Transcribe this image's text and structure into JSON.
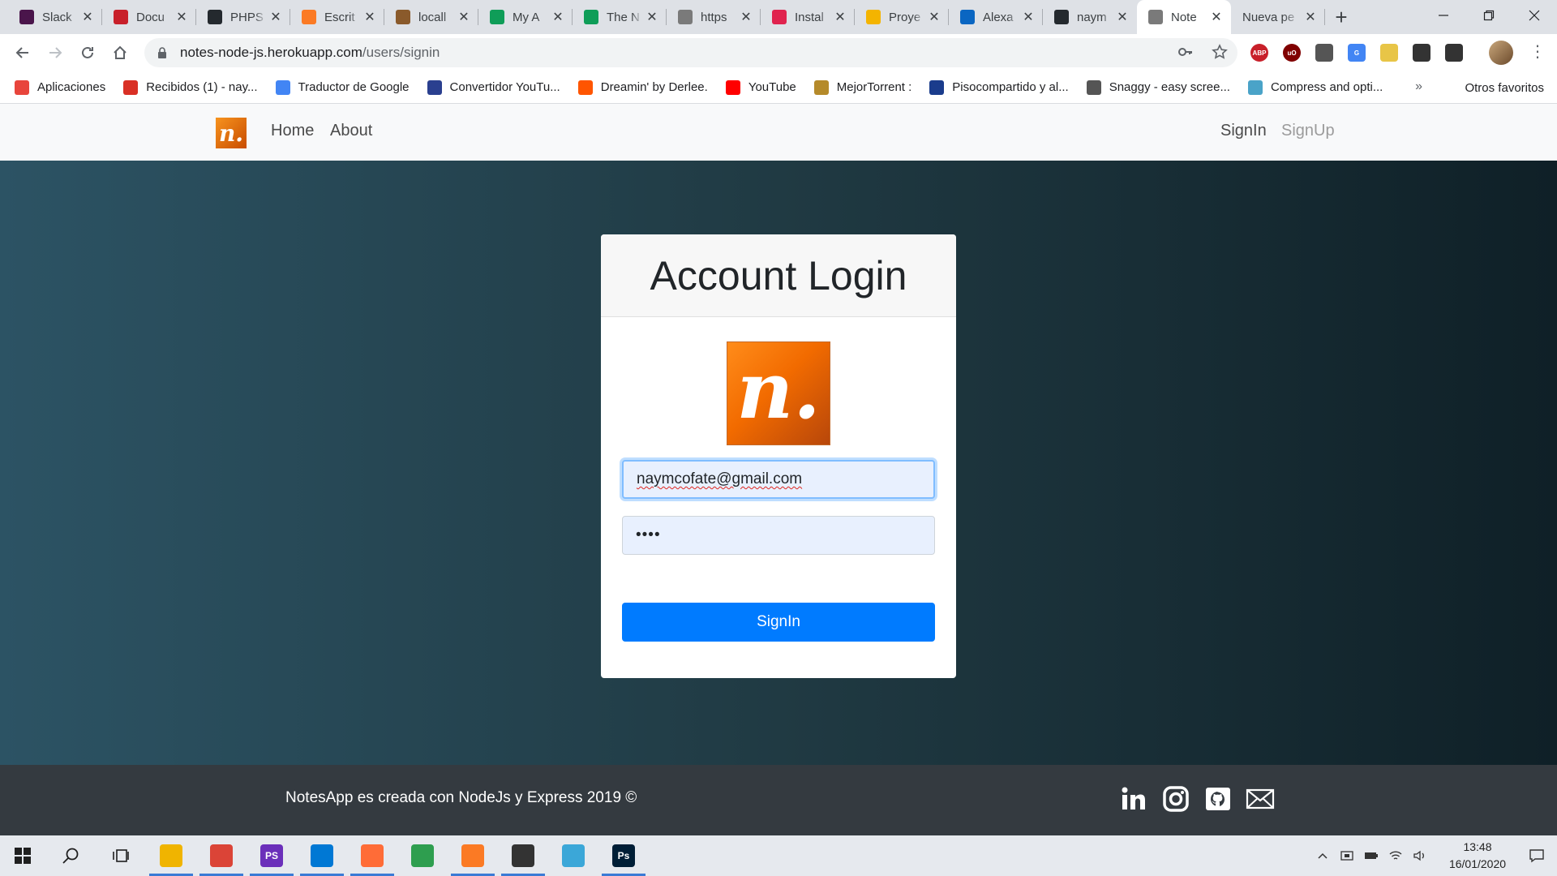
{
  "browser": {
    "tabs": [
      {
        "title": "Slack",
        "icon": "slack-icon",
        "color": "#4a154b"
      },
      {
        "title": "Docu",
        "icon": "pdf-icon",
        "color": "#c8202a"
      },
      {
        "title": "PHPS",
        "icon": "github-icon",
        "color": "#24292e"
      },
      {
        "title": "Escrit",
        "icon": "xampp-icon",
        "color": "#fb7a24"
      },
      {
        "title": "locall",
        "icon": "tent-icon",
        "color": "#8a5a2b"
      },
      {
        "title": "My A",
        "icon": "sheet-icon",
        "color": "#0f9d58"
      },
      {
        "title": "The N",
        "icon": "sheet-icon",
        "color": "#0f9d58"
      },
      {
        "title": "https",
        "icon": "globe-icon",
        "color": "#7a7a7a"
      },
      {
        "title": "Instal",
        "icon": "nest-icon",
        "color": "#e0234e"
      },
      {
        "title": "Proye",
        "icon": "slides-icon",
        "color": "#f4b400"
      },
      {
        "title": "Alexa",
        "icon": "linkedin-icon",
        "color": "#0a66c2"
      },
      {
        "title": "naym",
        "icon": "github-icon",
        "color": "#24292e"
      },
      {
        "title": "Note",
        "icon": "globe-icon",
        "color": "#7a7a7a",
        "active": true
      },
      {
        "title": "Nueva pe",
        "icon": "none",
        "color": "#ffffff"
      }
    ],
    "new_tab_label": "+",
    "url_host": "notes-node-js.herokuapp.com",
    "url_path": "/users/signin",
    "extensions": [
      {
        "label": "ABP",
        "color": "#c8202a"
      },
      {
        "label": "uO",
        "color": "#800000"
      },
      {
        "label": "",
        "color": "#555555"
      },
      {
        "label": "G",
        "color": "#4285f4"
      },
      {
        "label": "",
        "color": "#e8c547"
      },
      {
        "label": "",
        "color": "#333333"
      },
      {
        "label": "",
        "color": "#333333"
      }
    ],
    "bookmarks": [
      {
        "label": "Aplicaciones",
        "color": "#e8453c"
      },
      {
        "label": "Recibidos (1) - nay...",
        "color": "#d93025"
      },
      {
        "label": "Traductor de Google",
        "color": "#4285f4"
      },
      {
        "label": "Convertidor YouTu...",
        "color": "#2a3f8f"
      },
      {
        "label": "Dreamin' by Derlee.",
        "color": "#ff5500"
      },
      {
        "label": "YouTube",
        "color": "#ff0000"
      },
      {
        "label": "MejorTorrent :",
        "color": "#b58a2a"
      },
      {
        "label": "Pisocompartido y al...",
        "color": "#1a3c8c"
      },
      {
        "label": "Snaggy - easy scree...",
        "color": "#555555"
      },
      {
        "label": "Compress and opti...",
        "color": "#4aa3c8"
      }
    ],
    "bookmarks_more": "»",
    "other_bookmarks": "Otros favoritos"
  },
  "site": {
    "nav": {
      "brand": "n.",
      "links": [
        "Home",
        "About"
      ],
      "right_links": [
        "SignIn",
        "SignUp"
      ]
    },
    "login": {
      "title": "Account Login",
      "logo_letter": "n.",
      "email": "naymcofate@gmail.com",
      "password": "••••",
      "submit": "SignIn"
    },
    "footer": {
      "text": "NotesApp es creada con NodeJs y Express 2019 ©",
      "socials": [
        "linkedin-icon",
        "instagram-icon",
        "github-icon",
        "mail-icon"
      ]
    }
  },
  "taskbar": {
    "apps": [
      {
        "name": "file-explorer-icon",
        "color": "#f0b400",
        "label": "",
        "active": true
      },
      {
        "name": "chrome-icon",
        "color": "#db4437",
        "label": "",
        "active": true
      },
      {
        "name": "phpstorm-icon",
        "color": "#6b2fba",
        "label": "PS",
        "active": true
      },
      {
        "name": "vscode-icon",
        "color": "#0078d4",
        "label": "",
        "active": true
      },
      {
        "name": "postman-icon",
        "color": "#ff6c37",
        "label": "",
        "active": true
      },
      {
        "name": "robo3t-icon",
        "color": "#2e9e4f",
        "label": "",
        "active": false
      },
      {
        "name": "xampp-icon",
        "color": "#fb7a24",
        "label": "",
        "active": true
      },
      {
        "name": "editor-icon",
        "color": "#333333",
        "label": "",
        "active": true
      },
      {
        "name": "notepad-icon",
        "color": "#3ba7d8",
        "label": "",
        "active": false
      },
      {
        "name": "photoshop-icon",
        "color": "#001e36",
        "label": "Ps",
        "active": true
      }
    ],
    "time": "13:48",
    "date": "16/01/2020"
  }
}
